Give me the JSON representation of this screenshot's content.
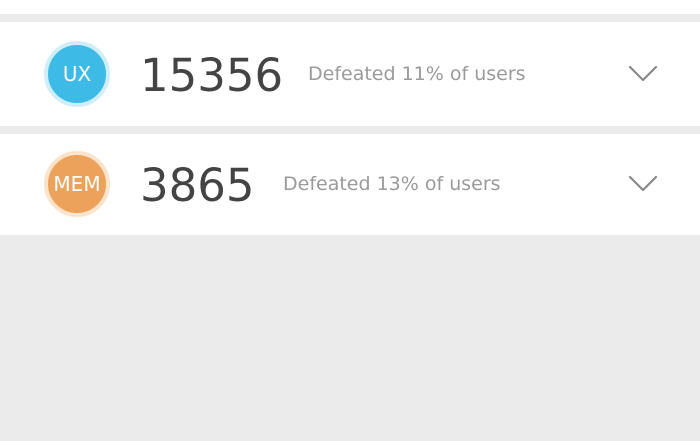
{
  "results": [
    {
      "badge": "UX",
      "badge_color": "#3dbbe6",
      "badge_ring": "#cfeefa",
      "score": "15356",
      "defeated_text": "Defeated 11% of users",
      "expand_icon": "chevron-down-icon"
    },
    {
      "badge": "MEM",
      "badge_color": "#eca25a",
      "badge_ring": "#fbe4cc",
      "score": "3865",
      "defeated_text": "Defeated 13% of users",
      "expand_icon": "chevron-down-icon"
    }
  ],
  "colors": {
    "background": "#ebebeb",
    "card": "#ffffff",
    "score_text": "#444444",
    "secondary_text": "#9a9a9a"
  }
}
